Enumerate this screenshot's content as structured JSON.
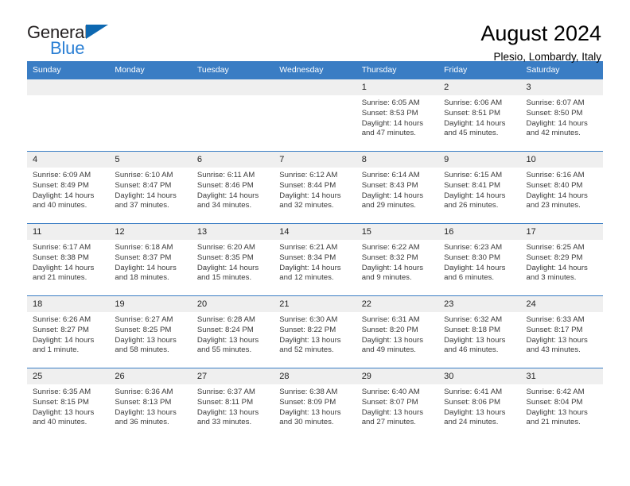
{
  "brand": {
    "name_part1": "General",
    "name_part2": "Blue",
    "logo_icon": "triangle-flag-icon"
  },
  "header": {
    "title": "August 2024",
    "subtitle": "Plesio, Lombardy, Italy"
  },
  "colors": {
    "header_blue": "#3a7dc4",
    "brand_blue": "#2a7fd4",
    "logo_triangle": "#0d68b1",
    "daynum_bg": "#efefef",
    "text": "#3a3a3a"
  },
  "weekday_headers": [
    "Sunday",
    "Monday",
    "Tuesday",
    "Wednesday",
    "Thursday",
    "Friday",
    "Saturday"
  ],
  "labels": {
    "sunrise": "Sunrise:",
    "sunset": "Sunset:",
    "daylight": "Daylight:"
  },
  "weeks": [
    [
      {
        "day": "",
        "blank": true,
        "sunrise": "",
        "sunset": "",
        "daylight_line1": "",
        "daylight_line2": ""
      },
      {
        "day": "",
        "blank": true,
        "sunrise": "",
        "sunset": "",
        "daylight_line1": "",
        "daylight_line2": ""
      },
      {
        "day": "",
        "blank": true,
        "sunrise": "",
        "sunset": "",
        "daylight_line1": "",
        "daylight_line2": ""
      },
      {
        "day": "",
        "blank": true,
        "sunrise": "",
        "sunset": "",
        "daylight_line1": "",
        "daylight_line2": ""
      },
      {
        "day": "1",
        "blank": false,
        "sunrise": "Sunrise: 6:05 AM",
        "sunset": "Sunset: 8:53 PM",
        "daylight_line1": "Daylight: 14 hours",
        "daylight_line2": "and 47 minutes."
      },
      {
        "day": "2",
        "blank": false,
        "sunrise": "Sunrise: 6:06 AM",
        "sunset": "Sunset: 8:51 PM",
        "daylight_line1": "Daylight: 14 hours",
        "daylight_line2": "and 45 minutes."
      },
      {
        "day": "3",
        "blank": false,
        "sunrise": "Sunrise: 6:07 AM",
        "sunset": "Sunset: 8:50 PM",
        "daylight_line1": "Daylight: 14 hours",
        "daylight_line2": "and 42 minutes."
      }
    ],
    [
      {
        "day": "4",
        "blank": false,
        "sunrise": "Sunrise: 6:09 AM",
        "sunset": "Sunset: 8:49 PM",
        "daylight_line1": "Daylight: 14 hours",
        "daylight_line2": "and 40 minutes."
      },
      {
        "day": "5",
        "blank": false,
        "sunrise": "Sunrise: 6:10 AM",
        "sunset": "Sunset: 8:47 PM",
        "daylight_line1": "Daylight: 14 hours",
        "daylight_line2": "and 37 minutes."
      },
      {
        "day": "6",
        "blank": false,
        "sunrise": "Sunrise: 6:11 AM",
        "sunset": "Sunset: 8:46 PM",
        "daylight_line1": "Daylight: 14 hours",
        "daylight_line2": "and 34 minutes."
      },
      {
        "day": "7",
        "blank": false,
        "sunrise": "Sunrise: 6:12 AM",
        "sunset": "Sunset: 8:44 PM",
        "daylight_line1": "Daylight: 14 hours",
        "daylight_line2": "and 32 minutes."
      },
      {
        "day": "8",
        "blank": false,
        "sunrise": "Sunrise: 6:14 AM",
        "sunset": "Sunset: 8:43 PM",
        "daylight_line1": "Daylight: 14 hours",
        "daylight_line2": "and 29 minutes."
      },
      {
        "day": "9",
        "blank": false,
        "sunrise": "Sunrise: 6:15 AM",
        "sunset": "Sunset: 8:41 PM",
        "daylight_line1": "Daylight: 14 hours",
        "daylight_line2": "and 26 minutes."
      },
      {
        "day": "10",
        "blank": false,
        "sunrise": "Sunrise: 6:16 AM",
        "sunset": "Sunset: 8:40 PM",
        "daylight_line1": "Daylight: 14 hours",
        "daylight_line2": "and 23 minutes."
      }
    ],
    [
      {
        "day": "11",
        "blank": false,
        "sunrise": "Sunrise: 6:17 AM",
        "sunset": "Sunset: 8:38 PM",
        "daylight_line1": "Daylight: 14 hours",
        "daylight_line2": "and 21 minutes."
      },
      {
        "day": "12",
        "blank": false,
        "sunrise": "Sunrise: 6:18 AM",
        "sunset": "Sunset: 8:37 PM",
        "daylight_line1": "Daylight: 14 hours",
        "daylight_line2": "and 18 minutes."
      },
      {
        "day": "13",
        "blank": false,
        "sunrise": "Sunrise: 6:20 AM",
        "sunset": "Sunset: 8:35 PM",
        "daylight_line1": "Daylight: 14 hours",
        "daylight_line2": "and 15 minutes."
      },
      {
        "day": "14",
        "blank": false,
        "sunrise": "Sunrise: 6:21 AM",
        "sunset": "Sunset: 8:34 PM",
        "daylight_line1": "Daylight: 14 hours",
        "daylight_line2": "and 12 minutes."
      },
      {
        "day": "15",
        "blank": false,
        "sunrise": "Sunrise: 6:22 AM",
        "sunset": "Sunset: 8:32 PM",
        "daylight_line1": "Daylight: 14 hours",
        "daylight_line2": "and 9 minutes."
      },
      {
        "day": "16",
        "blank": false,
        "sunrise": "Sunrise: 6:23 AM",
        "sunset": "Sunset: 8:30 PM",
        "daylight_line1": "Daylight: 14 hours",
        "daylight_line2": "and 6 minutes."
      },
      {
        "day": "17",
        "blank": false,
        "sunrise": "Sunrise: 6:25 AM",
        "sunset": "Sunset: 8:29 PM",
        "daylight_line1": "Daylight: 14 hours",
        "daylight_line2": "and 3 minutes."
      }
    ],
    [
      {
        "day": "18",
        "blank": false,
        "sunrise": "Sunrise: 6:26 AM",
        "sunset": "Sunset: 8:27 PM",
        "daylight_line1": "Daylight: 14 hours",
        "daylight_line2": "and 1 minute."
      },
      {
        "day": "19",
        "blank": false,
        "sunrise": "Sunrise: 6:27 AM",
        "sunset": "Sunset: 8:25 PM",
        "daylight_line1": "Daylight: 13 hours",
        "daylight_line2": "and 58 minutes."
      },
      {
        "day": "20",
        "blank": false,
        "sunrise": "Sunrise: 6:28 AM",
        "sunset": "Sunset: 8:24 PM",
        "daylight_line1": "Daylight: 13 hours",
        "daylight_line2": "and 55 minutes."
      },
      {
        "day": "21",
        "blank": false,
        "sunrise": "Sunrise: 6:30 AM",
        "sunset": "Sunset: 8:22 PM",
        "daylight_line1": "Daylight: 13 hours",
        "daylight_line2": "and 52 minutes."
      },
      {
        "day": "22",
        "blank": false,
        "sunrise": "Sunrise: 6:31 AM",
        "sunset": "Sunset: 8:20 PM",
        "daylight_line1": "Daylight: 13 hours",
        "daylight_line2": "and 49 minutes."
      },
      {
        "day": "23",
        "blank": false,
        "sunrise": "Sunrise: 6:32 AM",
        "sunset": "Sunset: 8:18 PM",
        "daylight_line1": "Daylight: 13 hours",
        "daylight_line2": "and 46 minutes."
      },
      {
        "day": "24",
        "blank": false,
        "sunrise": "Sunrise: 6:33 AM",
        "sunset": "Sunset: 8:17 PM",
        "daylight_line1": "Daylight: 13 hours",
        "daylight_line2": "and 43 minutes."
      }
    ],
    [
      {
        "day": "25",
        "blank": false,
        "sunrise": "Sunrise: 6:35 AM",
        "sunset": "Sunset: 8:15 PM",
        "daylight_line1": "Daylight: 13 hours",
        "daylight_line2": "and 40 minutes."
      },
      {
        "day": "26",
        "blank": false,
        "sunrise": "Sunrise: 6:36 AM",
        "sunset": "Sunset: 8:13 PM",
        "daylight_line1": "Daylight: 13 hours",
        "daylight_line2": "and 36 minutes."
      },
      {
        "day": "27",
        "blank": false,
        "sunrise": "Sunrise: 6:37 AM",
        "sunset": "Sunset: 8:11 PM",
        "daylight_line1": "Daylight: 13 hours",
        "daylight_line2": "and 33 minutes."
      },
      {
        "day": "28",
        "blank": false,
        "sunrise": "Sunrise: 6:38 AM",
        "sunset": "Sunset: 8:09 PM",
        "daylight_line1": "Daylight: 13 hours",
        "daylight_line2": "and 30 minutes."
      },
      {
        "day": "29",
        "blank": false,
        "sunrise": "Sunrise: 6:40 AM",
        "sunset": "Sunset: 8:07 PM",
        "daylight_line1": "Daylight: 13 hours",
        "daylight_line2": "and 27 minutes."
      },
      {
        "day": "30",
        "blank": false,
        "sunrise": "Sunrise: 6:41 AM",
        "sunset": "Sunset: 8:06 PM",
        "daylight_line1": "Daylight: 13 hours",
        "daylight_line2": "and 24 minutes."
      },
      {
        "day": "31",
        "blank": false,
        "sunrise": "Sunrise: 6:42 AM",
        "sunset": "Sunset: 8:04 PM",
        "daylight_line1": "Daylight: 13 hours",
        "daylight_line2": "and 21 minutes."
      }
    ]
  ]
}
